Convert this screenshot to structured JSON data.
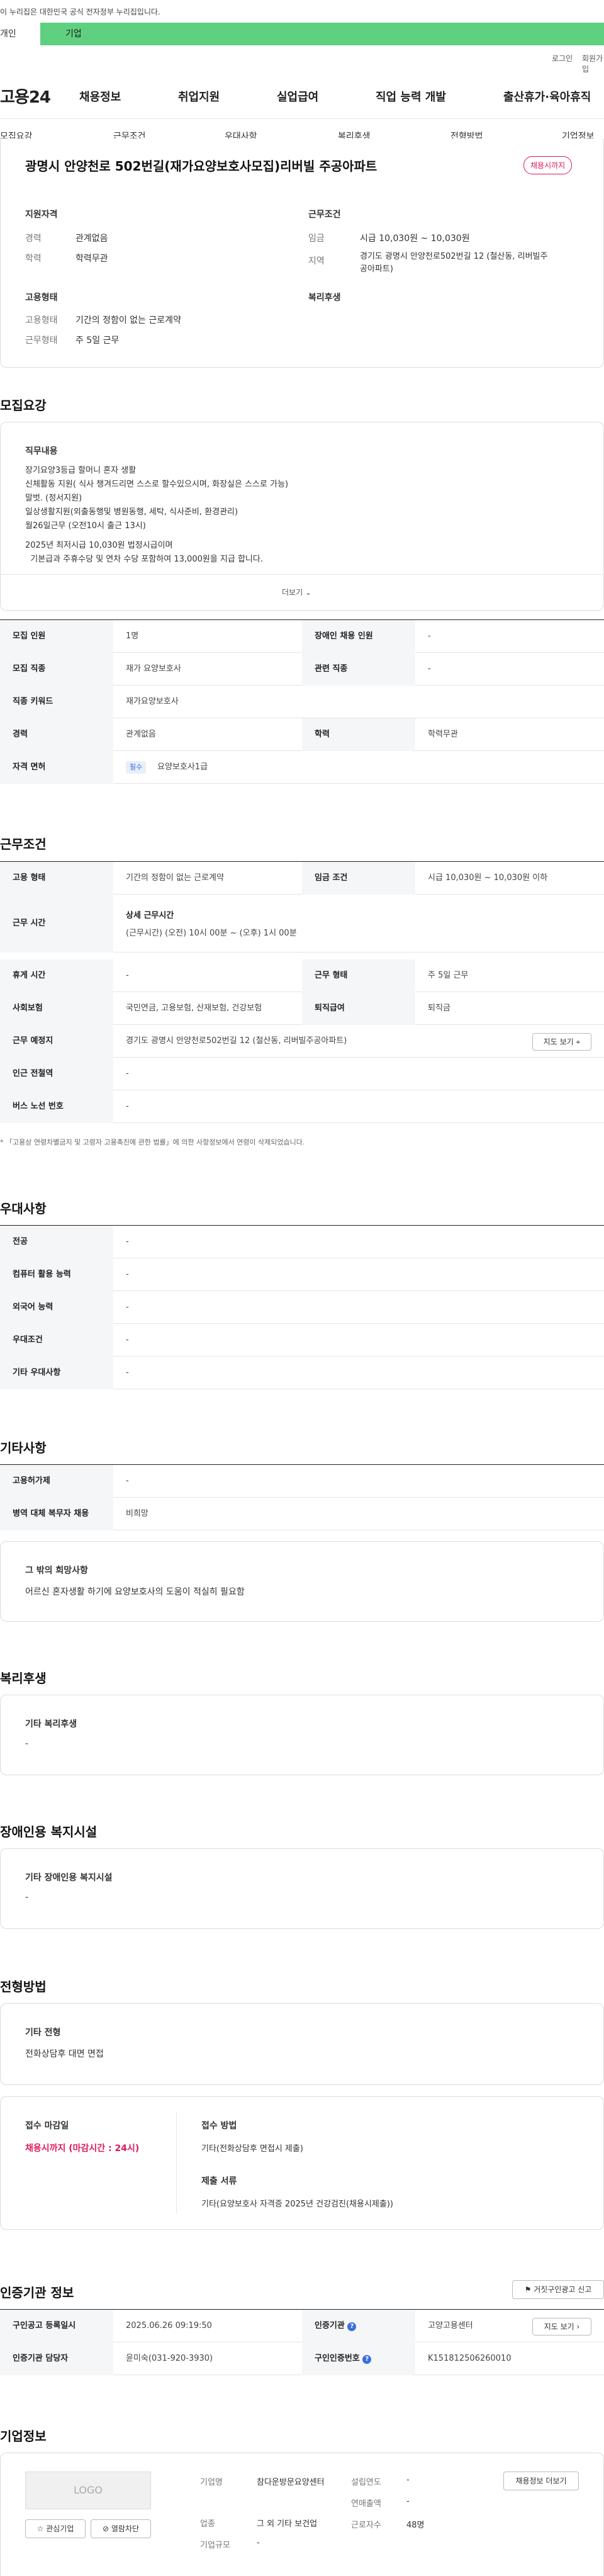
{
  "top": {
    "gov_text": "이 누리집은 대한민국 공식 전자정부 누리집입니다.",
    "user_tab": "개인",
    "corp_tab": "기업",
    "login": "로그인",
    "join": "회원가입"
  },
  "header": {
    "logo": "고용24",
    "menu": [
      "채용정보",
      "취업지원",
      "실업급여",
      "직업 능력 개발",
      "출산휴가·육아휴직"
    ]
  },
  "subnav": [
    "모집요강",
    "근무조건",
    "우대사항",
    "복리후생",
    "전형방법",
    "기업정보"
  ],
  "summary": {
    "title": "광명시 안양천로 502번길(재가요양보호사모집)리버빌 주공아파트",
    "badge": "채용시까지",
    "qual_title": "지원자격",
    "exp_k": "경력",
    "exp_v": "관계없음",
    "edu_k": "학력",
    "edu_v": "학력무관",
    "cond_title": "근무조건",
    "wage_k": "임금",
    "wage_v": "시급 10,030원 ~ 10,030원",
    "area_k": "지역",
    "area_v1": "경기도 광명시 안양천로502번길 12 (철산동, 리버빌주",
    "area_v2": "공아파트)",
    "emp_title": "고용형태",
    "type_k": "고용형태",
    "type_v": "기간의 정함이 없는 근로계약",
    "shape_k": "근무형태",
    "shape_v": "주 5일 근무",
    "welfare_title": "복리후생"
  },
  "recruit": {
    "title": "모집요강",
    "duty_title": "직무내용",
    "lines": [
      "장기요양3등급 할머니 혼자 생활",
      "신체활동 지원(  식사 챙겨드리면 스스로 할수있으시며, 화장실은 스스로 가능)",
      "말벗. (정서지원)",
      "일상생활지원(외출동행및 병원동행, 세탁, 식사준비, 환경관리)",
      "월26일근무 (오전10시 출근 13시)",
      "",
      "2025년 최저시급 10,030원  법정시급이며",
      "  기본급과 주휴수당 및 연차 수당 포함하여 13,000원을 지급 합니다."
    ],
    "more": "더보기",
    "rows": [
      [
        "모집 인원",
        "1명",
        "장애인 채용 인원",
        "-"
      ],
      [
        "모집 직종",
        "재가 요양보호사",
        "관련 직종",
        "-"
      ],
      [
        "직종 키워드",
        "재가요양보호사",
        "",
        ""
      ],
      [
        "경력",
        "관계없음",
        "학력",
        "학력무관"
      ]
    ],
    "license_k": "자격 면허",
    "license_tag": "필수",
    "license_v": "요양보호사1급"
  },
  "work": {
    "title": "근무조건",
    "type_k": "고용 형태",
    "type_v": "기간의 정함이 없는 근로계약",
    "wage_k": "임금 조건",
    "wage_v": "시급 10,030원 ~ 10,030원 이하",
    "time_k": "근무 시간",
    "time_title": "상세 근무시간",
    "time_v": "(근무시간) (오전) 10시 00분 ~ (오후) 1시 00분",
    "rest_k": "휴게 시간",
    "rest_v": "-",
    "shape_k": "근무 형태",
    "shape_v": "주 5일 근무",
    "ins_k": "사회보험",
    "ins_v": "국민연금, 고용보험, 산재보험, 건강보험",
    "ret_k": "퇴직급여",
    "ret_v": "퇴직금",
    "place_k": "근무 예정지",
    "place_v": "경기도 광명시 안양천로502번길 12 (철산동, 리버빌주공아파트)",
    "map_btn": "지도 보기",
    "sub_k": "인근 전철역",
    "sub_v": "-",
    "bus_k": "버스 노선 번호",
    "bus_v": "-",
    "note": "* 「고용상 연령차별금지 및 고령자 고용촉진에 관한 법률」에 의한 사항정보에서 연령이 삭제되었습니다."
  },
  "pref": {
    "title": "우대사항",
    "rows": [
      [
        "전공",
        "-"
      ],
      [
        "컴퓨터 활용 능력",
        "-"
      ],
      [
        "외국어 능력",
        "-"
      ],
      [
        "우대조건",
        "-"
      ],
      [
        "기타 우대사항",
        "-"
      ]
    ]
  },
  "etc": {
    "title": "기타사항",
    "rows": [
      [
        "고용허가제",
        "-"
      ],
      [
        "병역 대체 복무자 채용",
        "비희망"
      ]
    ],
    "box_title": "그 밖의 희망사항",
    "box_text": "어르신 혼자생활 하기에 요양보호사의 도움이 적실히 필요함"
  },
  "welfare": {
    "title": "복리후생",
    "box_title": "기타 복리후생",
    "box_text": "-"
  },
  "disabled": {
    "title": "장애인용 복지시설",
    "box_title": "기타 장애인용 복지시설",
    "box_text": "-"
  },
  "screen": {
    "title": "전형방법",
    "box_title": "기타 전형",
    "box_text": "전화상담후 대면 면접",
    "deadline_k": "접수 마감일",
    "deadline_v": "채용시까지 (마감시간 : 24시)",
    "method_k": "접수 방법",
    "method_v": "기타(전화상담후 면접시 제출)",
    "docs_k": "제출 서류",
    "docs_v": "기타(요양보호사 자격증 2025년 건강검진(채용시제출))"
  },
  "agency": {
    "title": "인증기관 정보",
    "report_btn": "거짓구인광고 신고",
    "reg_k": "구인공고 등록일시",
    "reg_v": "2025.06.26 09:19:50",
    "org_k": "인증기관",
    "org_v": "고양고용센터",
    "map_btn": "지도 보기",
    "mgr_k": "인증기관 담당자",
    "mgr_v": "윤미숙(031-920-3930)",
    "no_k": "구인인증번호",
    "no_v": "K151812506260010"
  },
  "company": {
    "title": "기업정보",
    "logo": "LOGO",
    "fav": "관심기업",
    "block": "열람차단",
    "name_k": "기업명",
    "name_v": "참다운방문요양센터",
    "ind_k": "업종",
    "ind_v": "그 외 기타 보건업",
    "size_k": "기업규모",
    "size_v": "-",
    "found_k": "설립연도",
    "found_v": "-",
    "sales_k": "연매출액",
    "sales_v": "-",
    "emp_k": "근로자수",
    "emp_v": "48명",
    "info_btn": "채용정보 더보기"
  }
}
